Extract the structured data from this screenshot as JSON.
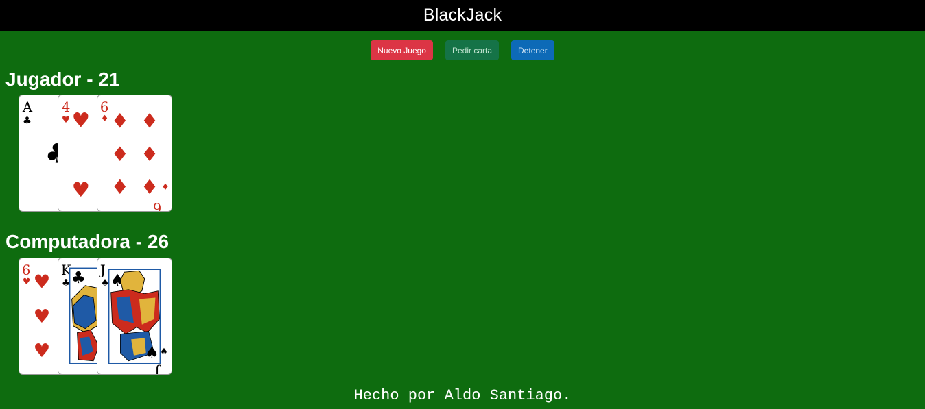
{
  "header": {
    "title": "BlackJack"
  },
  "controls": {
    "new_game_label": "Nuevo Juego",
    "hit_label": "Pedir carta",
    "stand_label": "Detener"
  },
  "player": {
    "name": "Jugador",
    "separator": "-",
    "score": "21",
    "cards": [
      {
        "rank": "A",
        "suit": "clubs"
      },
      {
        "rank": "4",
        "suit": "hearts"
      },
      {
        "rank": "6",
        "suit": "diamonds"
      }
    ]
  },
  "computer": {
    "name": "Computadora",
    "separator": "-",
    "score": "26",
    "cards": [
      {
        "rank": "6",
        "suit": "hearts"
      },
      {
        "rank": "K",
        "suit": "clubs"
      },
      {
        "rank": "J",
        "suit": "spades"
      }
    ]
  },
  "footer": {
    "credit": "Hecho por Aldo Santiago."
  },
  "colors": {
    "table": "#0e6c0f",
    "header_bg": "#000000",
    "new_game": "#dc3545",
    "hit": "#157347",
    "stand": "#0d6ab7",
    "red_suit": "#cc2b1d",
    "black_suit": "#000000"
  }
}
